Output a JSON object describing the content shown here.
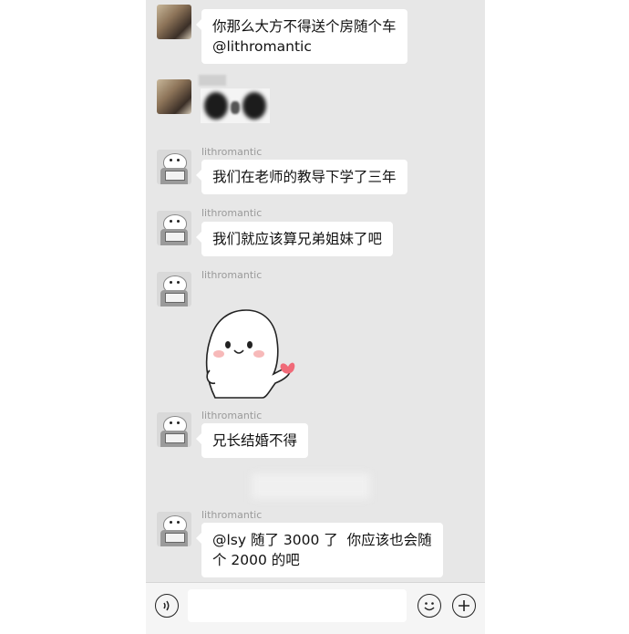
{
  "messages": [
    {
      "sender": "",
      "text": "你那么大方不得送个房随个车\n@lithromantic"
    },
    {
      "sender": "",
      "sticker": "blurred-face-sticker"
    },
    {
      "sender": "lithromantic",
      "text": "我们在老师的教导下学了三年"
    },
    {
      "sender": "lithromantic",
      "text": "我们就应该算兄弟姐妹了吧"
    },
    {
      "sender": "lithromantic",
      "sticker": "smiling-blob-heart-sticker"
    },
    {
      "sender": "lithromantic",
      "text": "兄长结婚不得"
    },
    {
      "sender": "lithromantic",
      "text": "@lsy 随了 3000 了  你应该也会随\n个 2000 的吧"
    }
  ],
  "input_bar": {
    "voice_icon": "voice-icon",
    "emoji_icon": "emoji-icon",
    "plus_icon": "plus-icon",
    "text_value": ""
  },
  "colors": {
    "chat_background": "#e7e7e7",
    "bubble": "#ffffff",
    "sender_text": "#9a9a9a"
  }
}
